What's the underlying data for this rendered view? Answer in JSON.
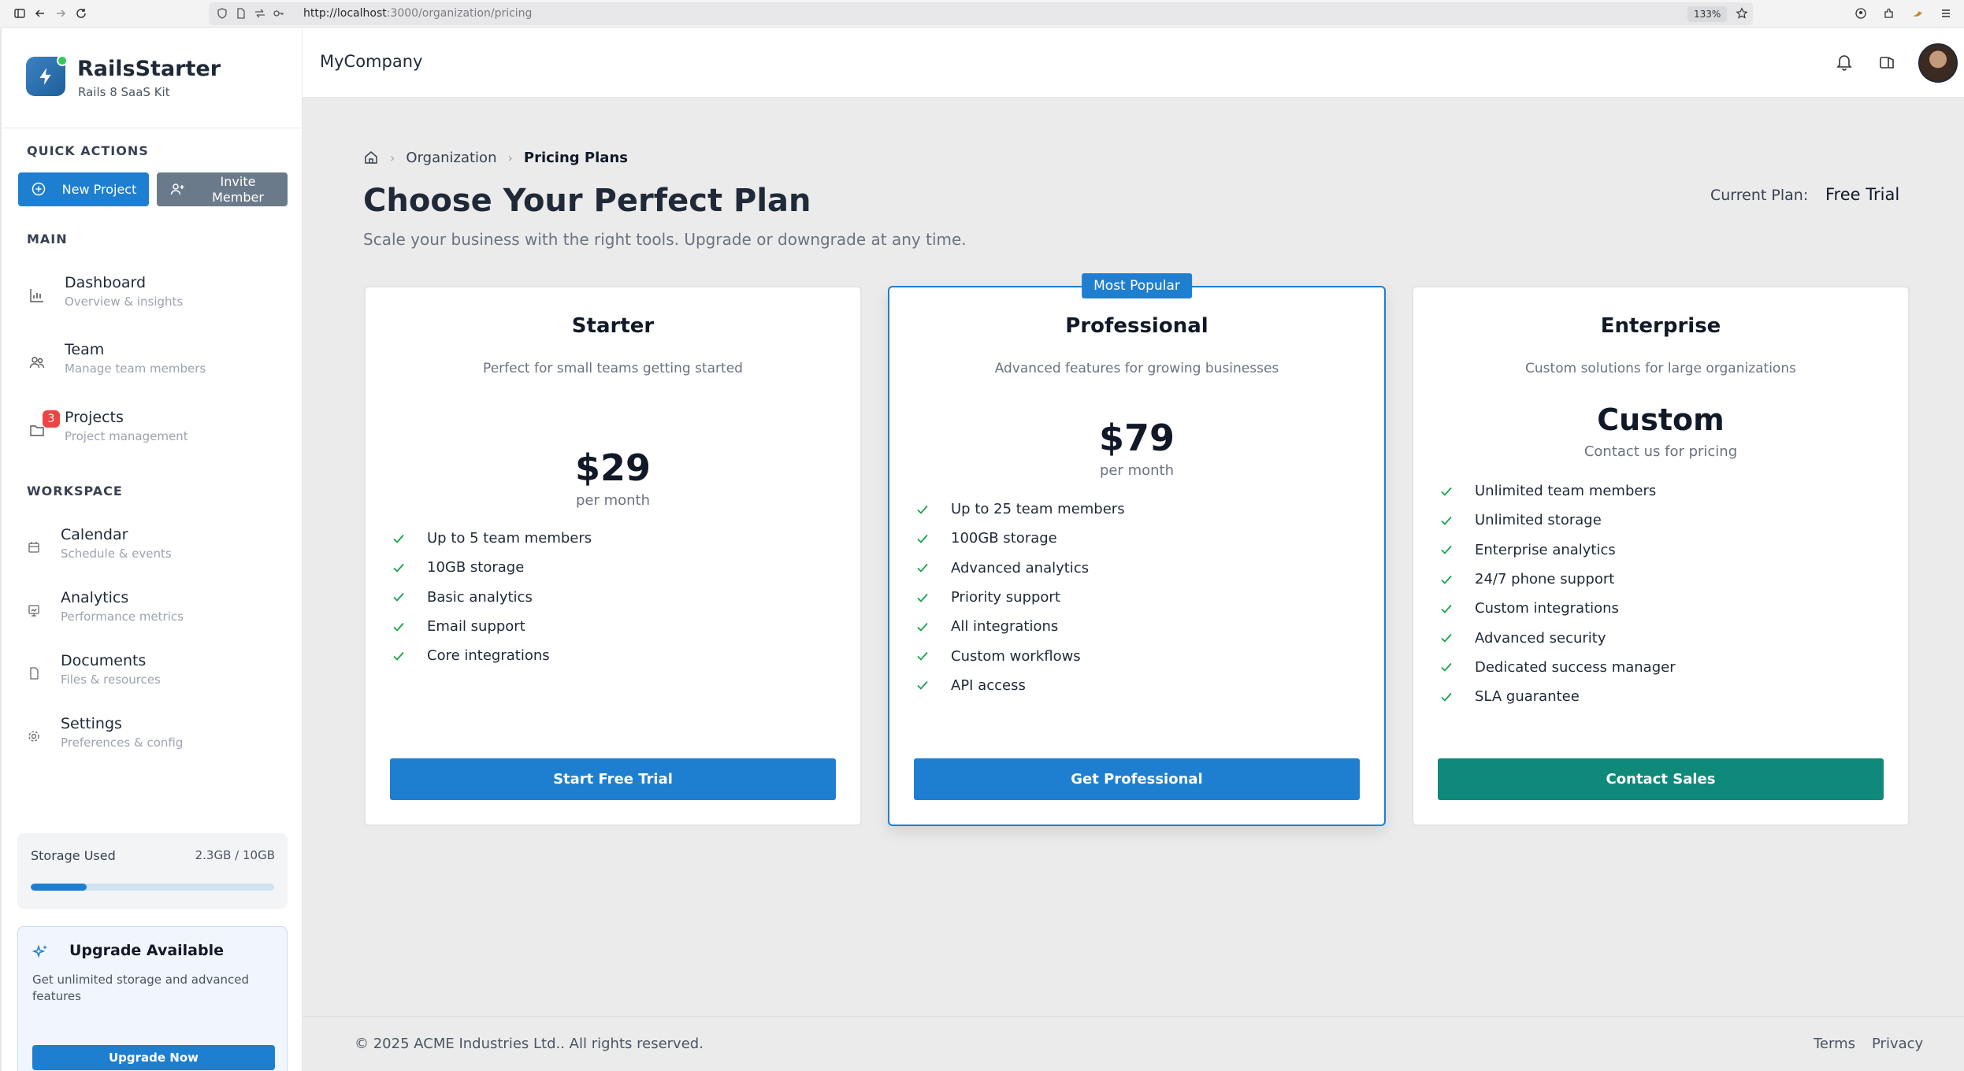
{
  "browser": {
    "url_host": "http://localhost",
    "url_rest": ":3000/organization/pricing",
    "zoom": "133%"
  },
  "brand": {
    "name": "RailsStarter",
    "tagline": "Rails 8 SaaS Kit"
  },
  "quick_actions": {
    "heading": "QUICK ACTIONS",
    "new_project": "New Project",
    "invite_member": "Invite Member"
  },
  "nav": {
    "main_heading": "MAIN",
    "workspace_heading": "WORKSPACE",
    "main_items": [
      {
        "title": "Dashboard",
        "sub": "Overview & insights",
        "icon": "chart-icon"
      },
      {
        "title": "Team",
        "sub": "Manage team members",
        "icon": "users-icon"
      },
      {
        "title": "Projects",
        "sub": "Project management",
        "icon": "folder-icon",
        "badge": "3"
      }
    ],
    "workspace_items": [
      {
        "title": "Calendar",
        "sub": "Schedule & events",
        "icon": "calendar-icon"
      },
      {
        "title": "Analytics",
        "sub": "Performance metrics",
        "icon": "analytics-icon"
      },
      {
        "title": "Documents",
        "sub": "Files & resources",
        "icon": "document-icon"
      },
      {
        "title": "Settings",
        "sub": "Preferences & config",
        "icon": "gear-icon"
      }
    ]
  },
  "storage": {
    "label": "Storage Used",
    "value": "2.3GB / 10GB",
    "fraction": 0.23
  },
  "upgrade": {
    "title": "Upgrade Available",
    "text": "Get unlimited storage and advanced features",
    "button": "Upgrade Now"
  },
  "header": {
    "company": "MyCompany"
  },
  "breadcrumb": {
    "parent": "Organization",
    "current": "Pricing Plans"
  },
  "page": {
    "title": "Choose Your Perfect Plan",
    "subtitle": "Scale your business with the right tools. Upgrade or downgrade at any time.",
    "current_plan_label": "Current Plan:",
    "current_plan_value": "Free Trial"
  },
  "plans": [
    {
      "name": "Starter",
      "desc": "Perfect for small teams getting started",
      "price": "$29",
      "period": "per month",
      "features": [
        "Up to 5 team members",
        "10GB storage",
        "Basic analytics",
        "Email support",
        "Core integrations"
      ],
      "button": "Start Free Trial"
    },
    {
      "name": "Professional",
      "ribbon": "Most Popular",
      "desc": "Advanced features for growing businesses",
      "price": "$79",
      "period": "per month",
      "features": [
        "Up to 25 team members",
        "100GB storage",
        "Advanced analytics",
        "Priority support",
        "All integrations",
        "Custom workflows",
        "API access"
      ],
      "button": "Get Professional"
    },
    {
      "name": "Enterprise",
      "desc": "Custom solutions for large organizations",
      "price": "Custom",
      "period": "Contact us for pricing",
      "features": [
        "Unlimited team members",
        "Unlimited storage",
        "Enterprise analytics",
        "24/7 phone support",
        "Custom integrations",
        "Advanced security",
        "Dedicated success manager",
        "SLA guarantee"
      ],
      "button": "Contact Sales"
    }
  ],
  "footer": {
    "copyright": "© 2025 ACME Industries Ltd.. All rights reserved.",
    "terms": "Terms",
    "privacy": "Privacy"
  },
  "colors": {
    "primary": "#1e7fd0",
    "enterprise_button": "#0f8a7a",
    "check": "#16a34a",
    "badge": "#ef4444"
  }
}
